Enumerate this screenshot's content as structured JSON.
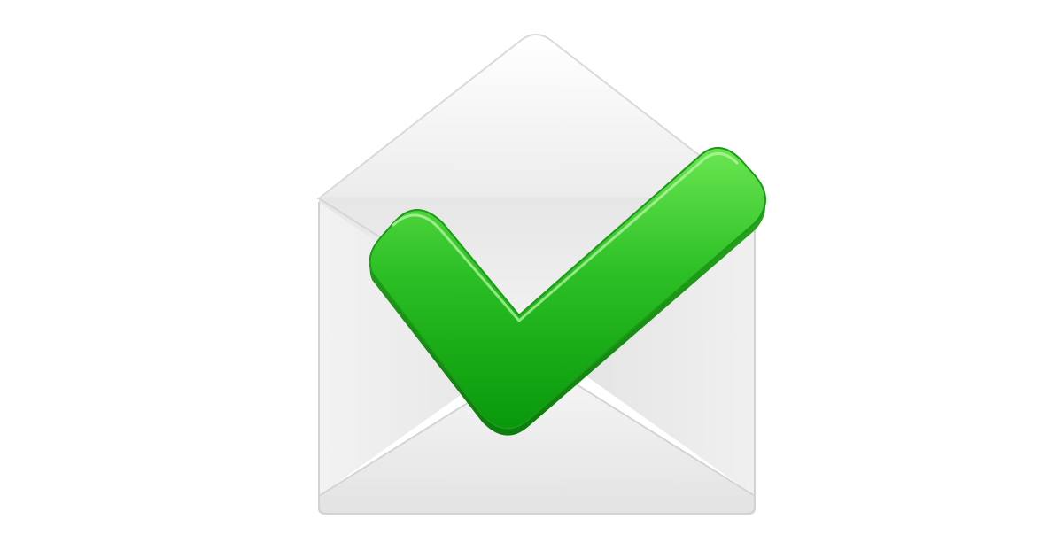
{
  "illustration": {
    "icon": "envelope-check-icon",
    "colors": {
      "background": "#ffffff",
      "envelope_light": "#f8f8f8",
      "envelope_mid": "#ececec",
      "envelope_shadow": "#d8d8d8",
      "check_light": "#5fe04a",
      "check_dark": "#0e9a0e"
    }
  }
}
